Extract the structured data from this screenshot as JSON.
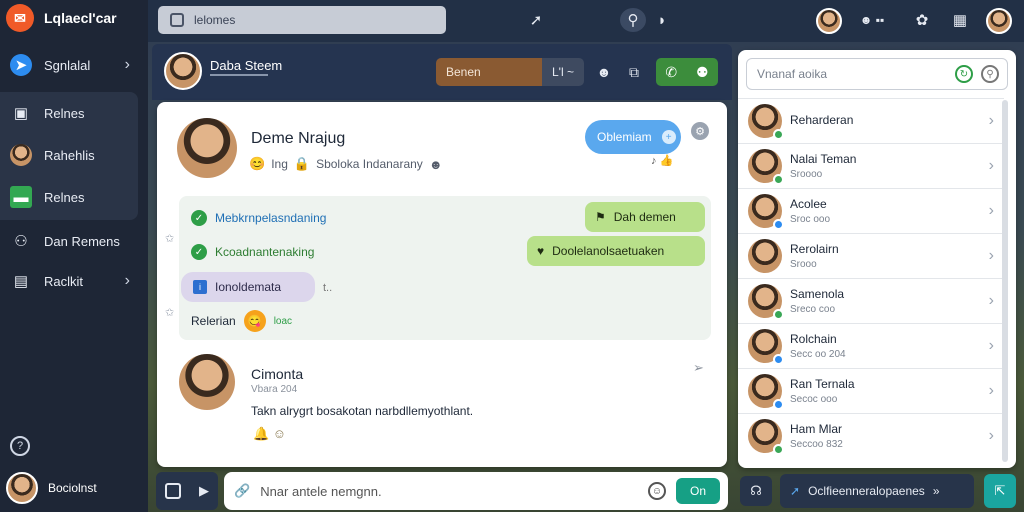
{
  "app": {
    "name": "Lqlaecl'car"
  },
  "sidebar": {
    "items": [
      {
        "label": "Sgnlalal",
        "icon": "send-icon"
      },
      {
        "label": "Relnes",
        "icon": "inbox-icon"
      },
      {
        "label": "Rahehlis",
        "icon": "person-icon"
      },
      {
        "label": "Relnes",
        "icon": "image-icon"
      },
      {
        "label": "Dan Remens",
        "icon": "team-icon"
      },
      {
        "label": "Raclkit",
        "icon": "bag-icon"
      }
    ],
    "profile_name": "Bociolnst"
  },
  "topbar": {
    "search_placeholder": "lelomes"
  },
  "chat": {
    "header_name": "Daba Steem",
    "status_label": "Benen",
    "status_tail": "L'l ~"
  },
  "post": {
    "author": "Deme Nrajug",
    "meta_a": "Ing",
    "meta_b": "Sboloka Indanarany",
    "bubble": "Oblemiam",
    "messages": [
      {
        "text": "Mebkrnpelasndaning",
        "pill": "Dah demen"
      },
      {
        "text": "Kcoadnantenaking",
        "pill": "Doolelanolsaetuaken"
      }
    ],
    "purple_pill": "Ionoldemata",
    "purple_suffix": "t..",
    "reply_label": "Relerian",
    "reply_suffix": "loac"
  },
  "comment": {
    "author": "Cimonta",
    "time": "Vbara 204",
    "body": "Takn alrygrt bosakotan narbdllemyothlant."
  },
  "composer": {
    "placeholder": "Nnar antele nemgnn.",
    "send_label": "On"
  },
  "contacts": {
    "search_placeholder": "Vnanaf aoika",
    "items": [
      {
        "name": "Reharderan",
        "sub": "",
        "status": "#3aa757"
      },
      {
        "name": "Nalai Teman",
        "sub": "Sroooo",
        "status": "#3aa757"
      },
      {
        "name": "Acolee",
        "sub": "Sroc ooo",
        "status": "#2d8cf0"
      },
      {
        "name": "Rerolairn",
        "sub": "Srooo",
        "status": ""
      },
      {
        "name": "Samenola",
        "sub": "Sreco coo",
        "status": "#3aa757"
      },
      {
        "name": "Rolchain",
        "sub": "Secc oo 204",
        "status": "#2d8cf0"
      },
      {
        "name": "Ran Ternala",
        "sub": "Secoc ooo",
        "status": "#2d8cf0"
      },
      {
        "name": "Ham Mlar",
        "sub": "Seccoo 832",
        "status": "#3aa757"
      }
    ]
  },
  "bottom": {
    "action_label": "Oclfieenneralopaenes"
  }
}
